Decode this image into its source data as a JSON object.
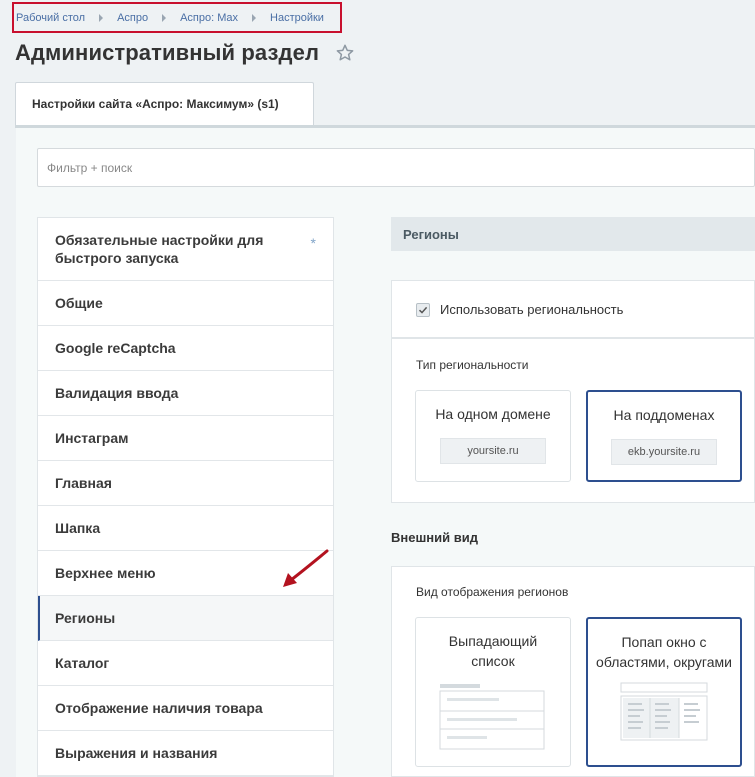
{
  "breadcrumb": [
    "Рабочий стол",
    "Аспро",
    "Аспро: Max",
    "Настройки"
  ],
  "page_title": "Административный раздел",
  "tab_label": "Настройки сайта «Аспро: Максимум» (s1)",
  "filter": {
    "placeholder": "Фильтр + поиск"
  },
  "menu": {
    "first_badge": "*",
    "items": [
      "Обязательные настройки для быстрого запуска",
      "Общие",
      "Google reCaptcha",
      "Валидация ввода",
      "Инстаграм",
      "Главная",
      "Шапка",
      "Верхнее меню",
      "Регионы",
      "Каталог",
      "Отображение наличия товара",
      "Выражения и названия"
    ],
    "active_index": 8
  },
  "regions": {
    "section_title": "Регионы",
    "use_regionality_label": "Использовать региональность",
    "use_regionality_checked": true,
    "type_label": "Тип региональности",
    "type_options": [
      {
        "title": "На одном домене",
        "url": "yoursite.ru",
        "selected": false
      },
      {
        "title": "На поддоменах",
        "url": "ekb.yoursite.ru",
        "selected": true
      }
    ]
  },
  "appearance": {
    "section_title": "Внешний вид",
    "display_label": "Вид отображения регионов",
    "display_options": [
      {
        "title": "Выпадающий список",
        "selected": false
      },
      {
        "title": "Попап окно с областями, округами",
        "selected": true
      }
    ]
  },
  "colors": {
    "accent": "#2d4f8f",
    "highlight_frame": "#c8102e",
    "arrow": "#c8102e"
  }
}
